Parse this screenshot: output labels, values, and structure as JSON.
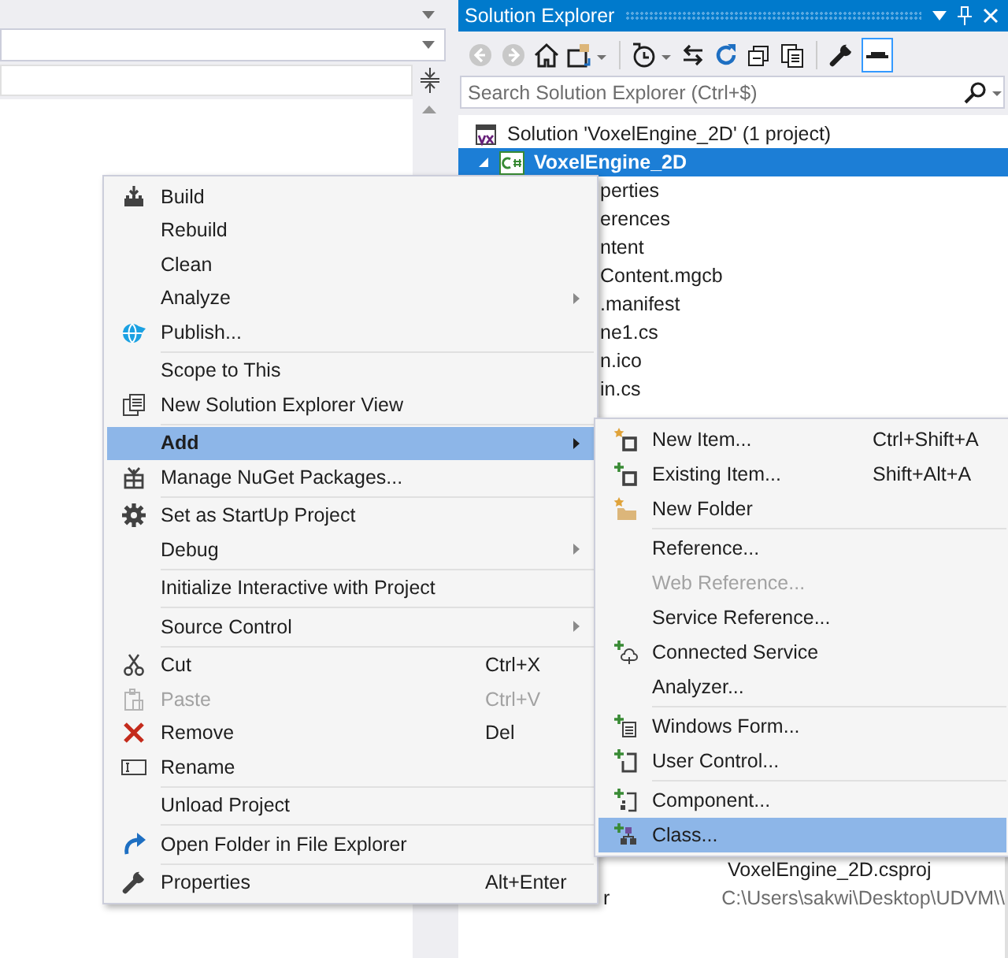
{
  "solution_explorer": {
    "title": "Solution Explorer",
    "search": {
      "placeholder": "Search Solution Explorer (Ctrl+$)"
    },
    "tree": [
      {
        "label": "Solution 'VoxelEngine_2D' (1 project)",
        "selected": false,
        "children": [
          {
            "label": "VoxelEngine_2D",
            "selected": true,
            "expanded": true,
            "children": [
              {
                "label": "perties",
                "selected": false
              },
              {
                "label": "erences",
                "selected": false
              },
              {
                "label": "ntent",
                "selected": false
              },
              {
                "label": "Content.mgcb",
                "selected": false
              },
              {
                "label": ".manifest",
                "selected": false
              },
              {
                "label": "ne1.cs",
                "selected": false
              },
              {
                "label": "n.ico",
                "selected": false
              },
              {
                "label": "in.cs",
                "selected": false
              }
            ]
          }
        ]
      }
    ],
    "properties": [
      {
        "value": "VoxelEngine_2D.csproj",
        "readonly": false
      },
      {
        "name": "r",
        "value": "C:\\Users\\sakwi\\Desktop\\UDVM\\\\",
        "readonly": true
      }
    ]
  },
  "context_menu": {
    "items": [
      {
        "kind": "item",
        "label": "Build",
        "disabled": false,
        "selected": false
      },
      {
        "kind": "item",
        "label": "Rebuild",
        "disabled": false,
        "selected": false
      },
      {
        "kind": "item",
        "label": "Clean",
        "disabled": false,
        "selected": false
      },
      {
        "kind": "item",
        "label": "Analyze",
        "submenu": true,
        "disabled": false,
        "selected": false
      },
      {
        "kind": "item",
        "label": "Publish...",
        "disabled": false,
        "selected": false
      },
      {
        "kind": "separator"
      },
      {
        "kind": "item",
        "label": "Scope to This",
        "disabled": false,
        "selected": false
      },
      {
        "kind": "item",
        "label": "New Solution Explorer View",
        "disabled": false,
        "selected": false
      },
      {
        "kind": "separator"
      },
      {
        "kind": "item",
        "label": "Add",
        "submenu": true,
        "disabled": false,
        "selected": true
      },
      {
        "kind": "item",
        "label": "Manage NuGet Packages...",
        "disabled": false,
        "selected": false
      },
      {
        "kind": "separator"
      },
      {
        "kind": "item",
        "label": "Set as StartUp Project",
        "disabled": false,
        "selected": false
      },
      {
        "kind": "item",
        "label": "Debug",
        "submenu": true,
        "disabled": false,
        "selected": false
      },
      {
        "kind": "separator"
      },
      {
        "kind": "item",
        "label": "Initialize Interactive with Project",
        "disabled": false,
        "selected": false
      },
      {
        "kind": "separator"
      },
      {
        "kind": "item",
        "label": "Source Control",
        "submenu": true,
        "disabled": false,
        "selected": false
      },
      {
        "kind": "separator"
      },
      {
        "kind": "item",
        "label": "Cut",
        "shortcut": "Ctrl+X",
        "disabled": false,
        "selected": false
      },
      {
        "kind": "item",
        "label": "Paste",
        "shortcut": "Ctrl+V",
        "disabled": true,
        "selected": false
      },
      {
        "kind": "item",
        "label": "Remove",
        "shortcut": "Del",
        "disabled": false,
        "selected": false
      },
      {
        "kind": "item",
        "label": "Rename",
        "disabled": false,
        "selected": false
      },
      {
        "kind": "separator"
      },
      {
        "kind": "item",
        "label": "Unload Project",
        "disabled": false,
        "selected": false
      },
      {
        "kind": "separator"
      },
      {
        "kind": "item",
        "label": "Open Folder in File Explorer",
        "disabled": false,
        "selected": false
      },
      {
        "kind": "separator"
      },
      {
        "kind": "item",
        "label": "Properties",
        "shortcut": "Alt+Enter",
        "disabled": false,
        "selected": false
      }
    ]
  },
  "add_submenu": {
    "items": [
      {
        "kind": "item",
        "label": "New Item...",
        "shortcut": "Ctrl+Shift+A",
        "disabled": false,
        "selected": false
      },
      {
        "kind": "item",
        "label": "Existing Item...",
        "shortcut": "Shift+Alt+A",
        "disabled": false,
        "selected": false
      },
      {
        "kind": "item",
        "label": "New Folder",
        "disabled": false,
        "selected": false
      },
      {
        "kind": "separator"
      },
      {
        "kind": "item",
        "label": "Reference...",
        "disabled": false,
        "selected": false
      },
      {
        "kind": "item",
        "label": "Web Reference...",
        "disabled": true,
        "selected": false
      },
      {
        "kind": "item",
        "label": "Service Reference...",
        "disabled": false,
        "selected": false
      },
      {
        "kind": "item",
        "label": "Connected Service",
        "disabled": false,
        "selected": false
      },
      {
        "kind": "item",
        "label": "Analyzer...",
        "disabled": false,
        "selected": false
      },
      {
        "kind": "separator"
      },
      {
        "kind": "item",
        "label": "Windows Form...",
        "disabled": false,
        "selected": false
      },
      {
        "kind": "item",
        "label": "User Control...",
        "disabled": false,
        "selected": false
      },
      {
        "kind": "separator"
      },
      {
        "kind": "item",
        "label": "Component...",
        "disabled": false,
        "selected": false
      },
      {
        "kind": "item",
        "label": "Class...",
        "disabled": false,
        "selected": true
      }
    ]
  }
}
